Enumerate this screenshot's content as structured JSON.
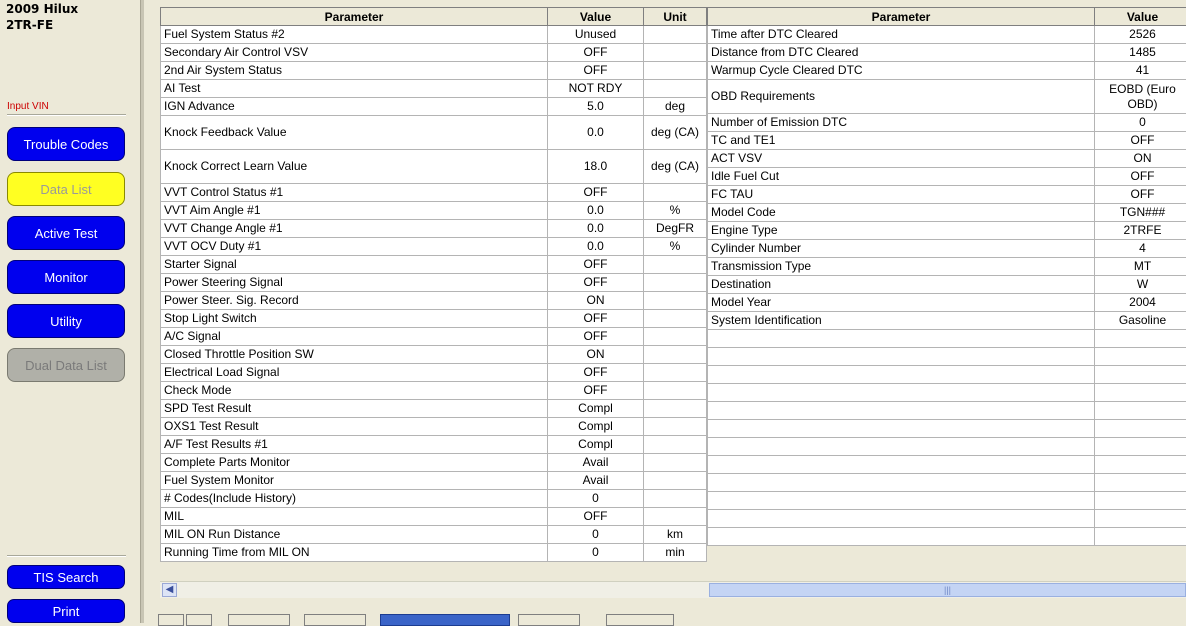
{
  "vehicle": {
    "model": "2009 Hilux",
    "engine": "2TR-FE"
  },
  "sidebar": {
    "input_vin": "Input VIN",
    "buttons": [
      {
        "label": "Trouble Codes",
        "state": "normal"
      },
      {
        "label": "Data List",
        "state": "active"
      },
      {
        "label": "Active Test",
        "state": "normal"
      },
      {
        "label": "Monitor",
        "state": "normal"
      },
      {
        "label": "Utility",
        "state": "normal"
      },
      {
        "label": "Dual Data List",
        "state": "disabled"
      }
    ],
    "tis_search": "TIS Search",
    "print": "Print"
  },
  "colors": {
    "button_blue": "#0000ee",
    "button_active": "#ffff22",
    "button_disabled": "#b0b0a8",
    "vin_red": "#cc0000"
  },
  "table_left": {
    "headers": [
      "Parameter",
      "Value",
      "Unit"
    ],
    "rows": [
      [
        "Fuel System Status #2",
        "Unused",
        ""
      ],
      [
        "Secondary Air Control VSV",
        "OFF",
        ""
      ],
      [
        "2nd Air System Status",
        "OFF",
        ""
      ],
      [
        "AI Test",
        "NOT RDY",
        ""
      ],
      [
        "IGN Advance",
        "5.0",
        "deg"
      ],
      [
        "Knock Feedback Value",
        "0.0",
        "deg (CA)"
      ],
      [
        "Knock Correct Learn Value",
        "18.0",
        "deg (CA)"
      ],
      [
        "VVT Control Status #1",
        "OFF",
        ""
      ],
      [
        "VVT Aim Angle #1",
        "0.0",
        "%"
      ],
      [
        "VVT Change Angle #1",
        "0.0",
        "DegFR"
      ],
      [
        "VVT OCV Duty #1",
        "0.0",
        "%"
      ],
      [
        "Starter Signal",
        "OFF",
        ""
      ],
      [
        "Power Steering Signal",
        "OFF",
        ""
      ],
      [
        "Power Steer. Sig. Record",
        "ON",
        ""
      ],
      [
        "Stop Light Switch",
        "OFF",
        ""
      ],
      [
        "A/C Signal",
        "OFF",
        ""
      ],
      [
        "Closed Throttle Position SW",
        "ON",
        ""
      ],
      [
        "Electrical Load Signal",
        "OFF",
        ""
      ],
      [
        "Check Mode",
        "OFF",
        ""
      ],
      [
        "SPD Test Result",
        "Compl",
        ""
      ],
      [
        "OXS1 Test Result",
        "Compl",
        ""
      ],
      [
        "A/F Test Results #1",
        "Compl",
        ""
      ],
      [
        "Complete Parts Monitor",
        "Avail",
        ""
      ],
      [
        "Fuel System Monitor",
        "Avail",
        ""
      ],
      [
        "# Codes(Include History)",
        "0",
        ""
      ],
      [
        "MIL",
        "OFF",
        ""
      ],
      [
        "MIL ON Run Distance",
        "0",
        "km"
      ],
      [
        "Running Time from MIL ON",
        "0",
        "min"
      ]
    ]
  },
  "table_right": {
    "headers": [
      "Parameter",
      "Value"
    ],
    "rows": [
      [
        "Time after DTC Cleared",
        "2526"
      ],
      [
        "Distance from DTC Cleared",
        "1485"
      ],
      [
        "Warmup Cycle Cleared DTC",
        "41"
      ],
      [
        "OBD Requirements",
        "EOBD (Euro OBD)"
      ],
      [
        "Number of Emission DTC",
        "0"
      ],
      [
        "TC and TE1",
        "OFF"
      ],
      [
        "ACT VSV",
        "ON"
      ],
      [
        "Idle Fuel Cut",
        "OFF"
      ],
      [
        "FC TAU",
        "OFF"
      ],
      [
        "Model Code",
        "TGN###"
      ],
      [
        "Engine Type",
        "2TRFE"
      ],
      [
        "Cylinder Number",
        "4"
      ],
      [
        "Transmission Type",
        "MT"
      ],
      [
        "Destination",
        "W"
      ],
      [
        "Model Year",
        "2004"
      ],
      [
        "System Identification",
        "Gasoline"
      ]
    ],
    "empty_rows": 12
  }
}
